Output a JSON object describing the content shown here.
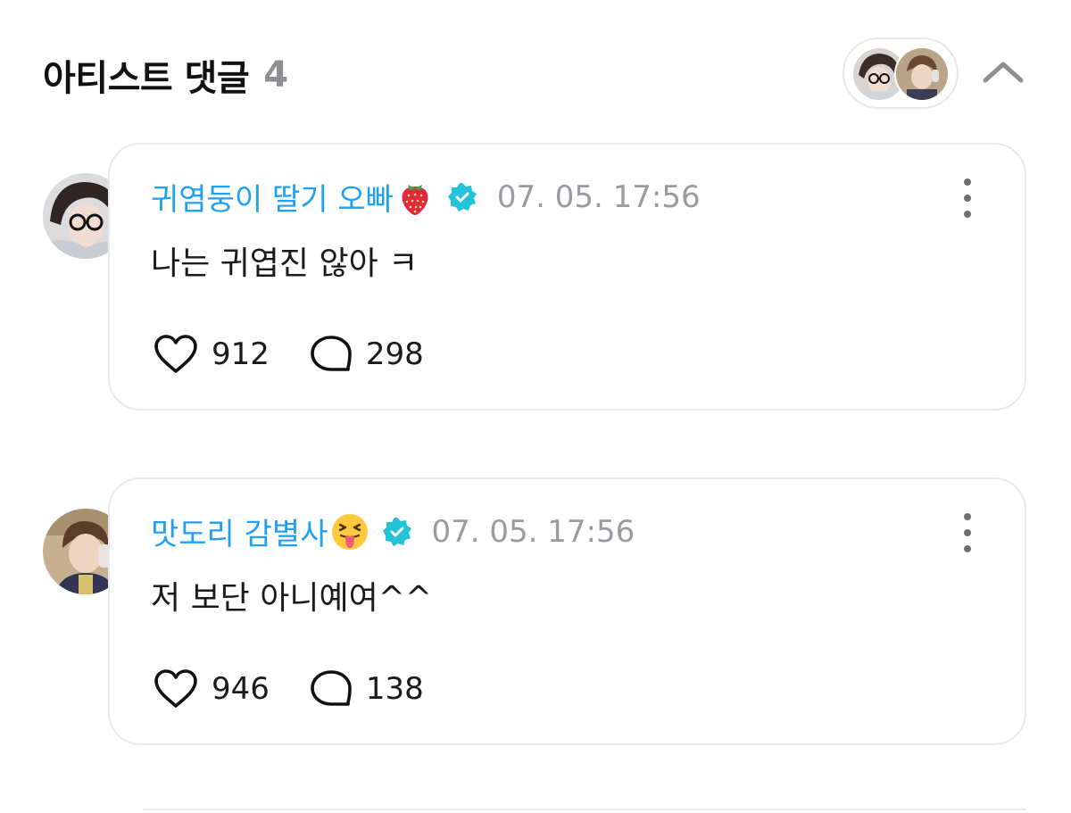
{
  "header": {
    "title": "아티스트 댓글",
    "count": "4"
  },
  "comments": [
    {
      "author": "귀염둥이 딸기 오빠",
      "author_emoji": "strawberry-emoji",
      "timestamp": "07. 05. 17:56",
      "text": "나는 귀엽진 않아 ㅋ",
      "likes": "912",
      "replies": "298"
    },
    {
      "author": "맛도리 감별사",
      "author_emoji": "squinting-tongue-emoji",
      "timestamp": "07. 05. 17:56",
      "text": "저 보단 아니예여^^",
      "likes": "946",
      "replies": "138"
    }
  ],
  "colors": {
    "author": "#1fa0f0",
    "verified": "#22c3d6",
    "timestamp": "#9a9aa0",
    "card_border": "#e8e8ee"
  }
}
